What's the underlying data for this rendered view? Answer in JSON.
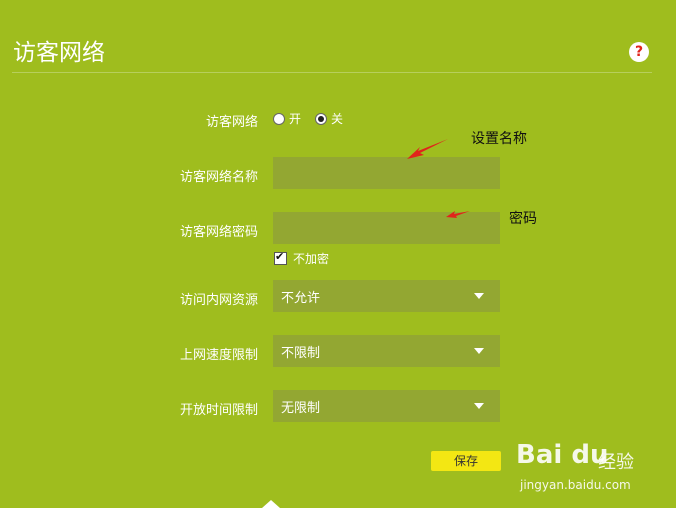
{
  "header": {
    "title": "访客网络",
    "help_icon": "?"
  },
  "form": {
    "guest_network": {
      "label": "访客网络",
      "options": [
        {
          "label": "开",
          "checked": false
        },
        {
          "label": "关",
          "checked": true
        }
      ]
    },
    "guest_name": {
      "label": "访客网络名称",
      "value": ""
    },
    "guest_password": {
      "label": "访客网络密码",
      "value": ""
    },
    "no_encryption": {
      "label": "不加密",
      "checked": true
    },
    "intranet_access": {
      "label": "访问内网资源",
      "value": "不允许"
    },
    "speed_limit": {
      "label": "上网速度限制",
      "value": "不限制"
    },
    "open_time_limit": {
      "label": "开放时间限制",
      "value": "无限制"
    },
    "save_label": "保存"
  },
  "annotations": {
    "name_note": "设置名称",
    "password_note": "密码"
  },
  "watermark": {
    "logo": "Bai du",
    "brand": "经验",
    "url": "jingyan.baidu.com"
  },
  "colors": {
    "background": "#9fbd1e",
    "field": "#93a732",
    "save": "#f3e713",
    "arrow": "#e0241b"
  },
  "icons": {
    "help": "question-circle-icon",
    "caret": "caret-down-icon",
    "arrow": "red-arrow-icon"
  }
}
